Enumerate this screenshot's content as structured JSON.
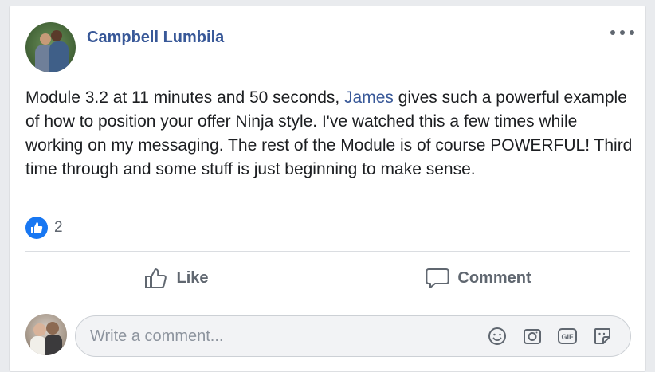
{
  "post": {
    "author": "Campbell Lumbila",
    "text_before": "Module 3.2 at 11 minutes and 50 seconds, ",
    "mention": "James",
    "text_after": " gives such a powerful example of how to position your offer Ninja style. I've watched this a few times while working on my messaging. The rest of the Module is of course POWERFUL! Third time through and some stuff is just beginning to make sense.",
    "reaction_count": "2"
  },
  "actions": {
    "like_label": "Like",
    "comment_label": "Comment"
  },
  "composer": {
    "placeholder": "Write a comment..."
  },
  "colors": {
    "link": "#385898",
    "reaction": "#1877f2",
    "muted": "#606770"
  },
  "icons": [
    "more-options-icon",
    "like-reaction-icon",
    "thumbs-up-icon",
    "comment-icon",
    "emoji-icon",
    "camera-icon",
    "gif-icon",
    "sticker-icon"
  ]
}
